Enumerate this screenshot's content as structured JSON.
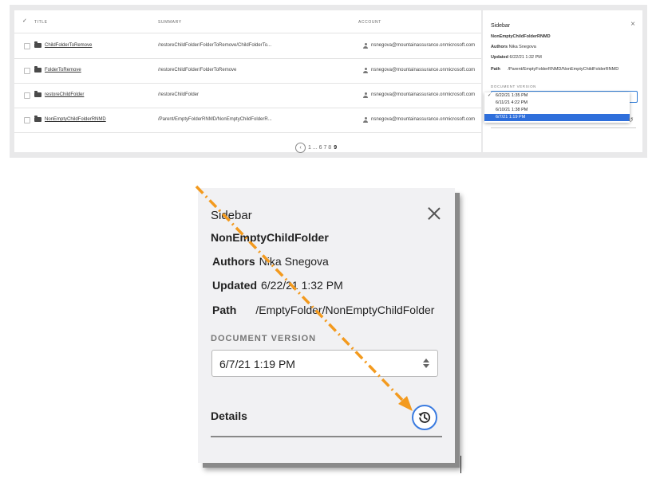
{
  "table": {
    "headers": {
      "title": "TITLE",
      "summary": "SUMMARY",
      "account": "ACCOUNT"
    },
    "rows": [
      {
        "title": "ChildFolderToRemove",
        "summary": "/restoreChildFolder/FolderToRemove/ChildFolderTo...",
        "account": "nsnegova@mountainassurance.onmicrosoft.com"
      },
      {
        "title": "FolderToRemove",
        "summary": "/restoreChildFolder/FolderToRemove",
        "account": "nsnegova@mountainassurance.onmicrosoft.com"
      },
      {
        "title": "restoreChildFolder",
        "summary": "/restoreChildFolder",
        "account": "nsnegova@mountainassurance.onmicrosoft.com"
      },
      {
        "title": "NonEmptyChildFolderRNMD",
        "summary": "/Parent/EmptyFolderRNMD/NonEmptyChildFolderR...",
        "account": "nsnegova@mountainassurance.onmicrosoft.com"
      }
    ]
  },
  "pagination": {
    "prev_icon": "chevron-left-icon",
    "pages_prefix": "1 ... 6 7 8",
    "current": "9"
  },
  "mini_sidebar": {
    "title": "Sidebar",
    "name": "NonEmptyChildFolderRNMD",
    "authors_label": "Authors",
    "authors_value": "Nika Snegova",
    "updated_label": "Updated",
    "updated_value": "6/22/21 1:32 PM",
    "path_label": "Path",
    "path_value": "/Parent/EmptyFolderRNMD/NonEmptyChildFolderRNMD",
    "doc_version_label": "DOCUMENT VERSION",
    "versions": [
      "6/22/21 1:35 PM",
      "6/11/21 4:22 PM",
      "6/10/21 1:38 PM",
      "6/7/21 1:19 PM"
    ],
    "checked_index": 0,
    "selected_index": 3
  },
  "zoom_sidebar": {
    "title": "Sidebar",
    "name": "NonEmptyChildFolder",
    "authors_label": "Authors",
    "authors_value": "Nika Snegova",
    "updated_label": "Updated",
    "updated_value": "6/22/21 1:32 PM",
    "path_label": "Path",
    "path_value": "/EmptyFolder/NonEmptyChildFolder",
    "doc_version_label": "DOCUMENT VERSION",
    "selected_version": "6/7/21 1:19 PM",
    "details_label": "Details"
  },
  "colors": {
    "accent_blue": "#3a7be0",
    "selection_blue": "#2f6fdb",
    "arrow_orange": "#f39a1e"
  }
}
